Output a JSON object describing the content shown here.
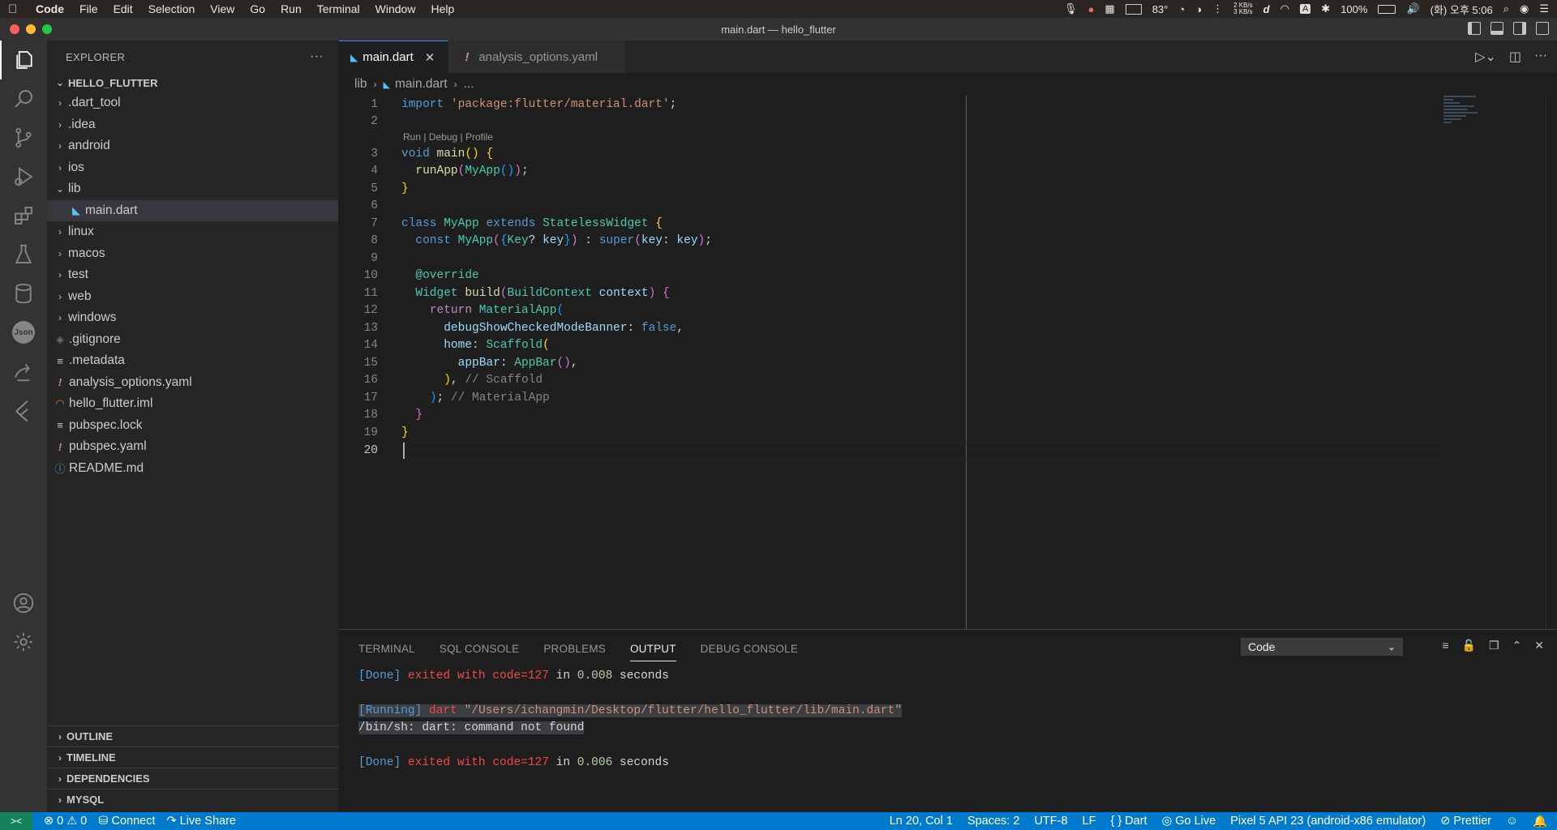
{
  "menubar": {
    "app": "Code",
    "items": [
      "File",
      "Edit",
      "Selection",
      "View",
      "Go",
      "Run",
      "Terminal",
      "Window",
      "Help"
    ],
    "temp": "83°",
    "net_up": "2 KB/s",
    "net_down": "3 KB/s",
    "battery": "100%",
    "clock": "(화) 오후 5:06",
    "input_letter": "A"
  },
  "window": {
    "title": "main.dart — hello_flutter"
  },
  "sidebar": {
    "header": "EXPLORER",
    "more": "···",
    "folder": "HELLO_FLUTTER",
    "items": [
      {
        "label": ".dart_tool",
        "type": "folder"
      },
      {
        "label": ".idea",
        "type": "folder"
      },
      {
        "label": "android",
        "type": "folder"
      },
      {
        "label": "ios",
        "type": "folder"
      },
      {
        "label": "lib",
        "type": "folder-open"
      },
      {
        "label": "main.dart",
        "type": "dart"
      },
      {
        "label": "linux",
        "type": "folder"
      },
      {
        "label": "macos",
        "type": "folder"
      },
      {
        "label": "test",
        "type": "folder"
      },
      {
        "label": "web",
        "type": "folder"
      },
      {
        "label": "windows",
        "type": "folder"
      },
      {
        "label": ".gitignore",
        "type": "git"
      },
      {
        "label": ".metadata",
        "type": "text"
      },
      {
        "label": "analysis_options.yaml",
        "type": "yaml"
      },
      {
        "label": "hello_flutter.iml",
        "type": "rss"
      },
      {
        "label": "pubspec.lock",
        "type": "text"
      },
      {
        "label": "pubspec.yaml",
        "type": "yaml"
      },
      {
        "label": "README.md",
        "type": "info"
      }
    ],
    "sections": [
      "OUTLINE",
      "TIMELINE",
      "DEPENDENCIES",
      "MYSQL"
    ]
  },
  "tabs": [
    {
      "label": "main.dart",
      "close": "✕"
    },
    {
      "label": "analysis_options.yaml"
    }
  ],
  "breadcrumb": {
    "folder": "lib",
    "file": "main.dart",
    "more": "..."
  },
  "editor": {
    "codelens": "Run | Debug | Profile",
    "line_numbers": [
      "1",
      "2",
      "3",
      "4",
      "5",
      "6",
      "7",
      "8",
      "9",
      "10",
      "11",
      "12",
      "13",
      "14",
      "15",
      "16",
      "17",
      "18",
      "19",
      "20"
    ]
  },
  "panel": {
    "tabs": [
      "TERMINAL",
      "SQL CONSOLE",
      "PROBLEMS",
      "OUTPUT",
      "DEBUG CONSOLE"
    ],
    "channel": "Code",
    "output": {
      "done1": "[Done]",
      "exited": " exited with ",
      "code1": "code=127",
      "in": " in ",
      "time1": "0.008",
      "seconds": " seconds",
      "running": "[Running]",
      "cmd": " dart ",
      "path": "\"/Users/ichangmin/Desktop/flutter/hello_flutter/lib/main.dart\"",
      "error": "/bin/sh: dart: command not found",
      "done2": "[Done]",
      "code2": "code=127",
      "time2": "0.006"
    }
  },
  "statusbar": {
    "remote": "><",
    "errors": "0",
    "warnings": "0",
    "connect": "Connect",
    "liveshare": "Live Share",
    "position": "Ln 20, Col 1",
    "spaces": "Spaces: 2",
    "encoding": "UTF-8",
    "eol": "LF",
    "language": "Dart",
    "golive": "Go Live",
    "device": "Pixel 5 API 23 (android-x86 emulator)",
    "prettier": "Prettier"
  }
}
